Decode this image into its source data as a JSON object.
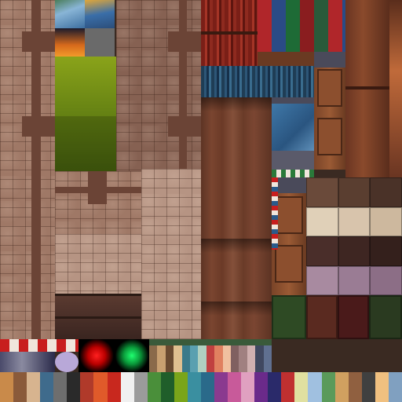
{
  "atlas": {
    "description_name": "",
    "swatch_colors_bottom": [
      "#c98a4a",
      "#8a5a3a",
      "#d7b48f",
      "#3f6b8c",
      "#6e6e6e",
      "#2a2a2a",
      "#b03a2a",
      "#e05a2a",
      "#c8281e",
      "#f0f0f0",
      "#9b9b9b",
      "#4a8f3a",
      "#1f5e2a",
      "#7aa51a",
      "#3a8fa0",
      "#2a6a8a",
      "#8a3a8f",
      "#c85a9a",
      "#e0a0c0",
      "#6a2a8a",
      "#2a2a6a",
      "#c03030",
      "#e0e0a0",
      "#a0c0e0",
      "#5a9a5a",
      "#d0a060",
      "#906040",
      "#404040",
      "#f0c080",
      "#80a0c0"
    ],
    "swatch_colors_mid": [
      "#8a6a4a",
      "#c8a070",
      "#6a4a30",
      "#e0c090",
      "#3a7a8a",
      "#5aa0b0",
      "#b0d0c0",
      "#c04040",
      "#e08060",
      "#f0c0a0",
      "#806060",
      "#a08080",
      "#d0b0b0",
      "#404860",
      "#607090"
    ],
    "stripe_colors": [
      "#c81e1e",
      "#f0e6dc"
    ]
  }
}
